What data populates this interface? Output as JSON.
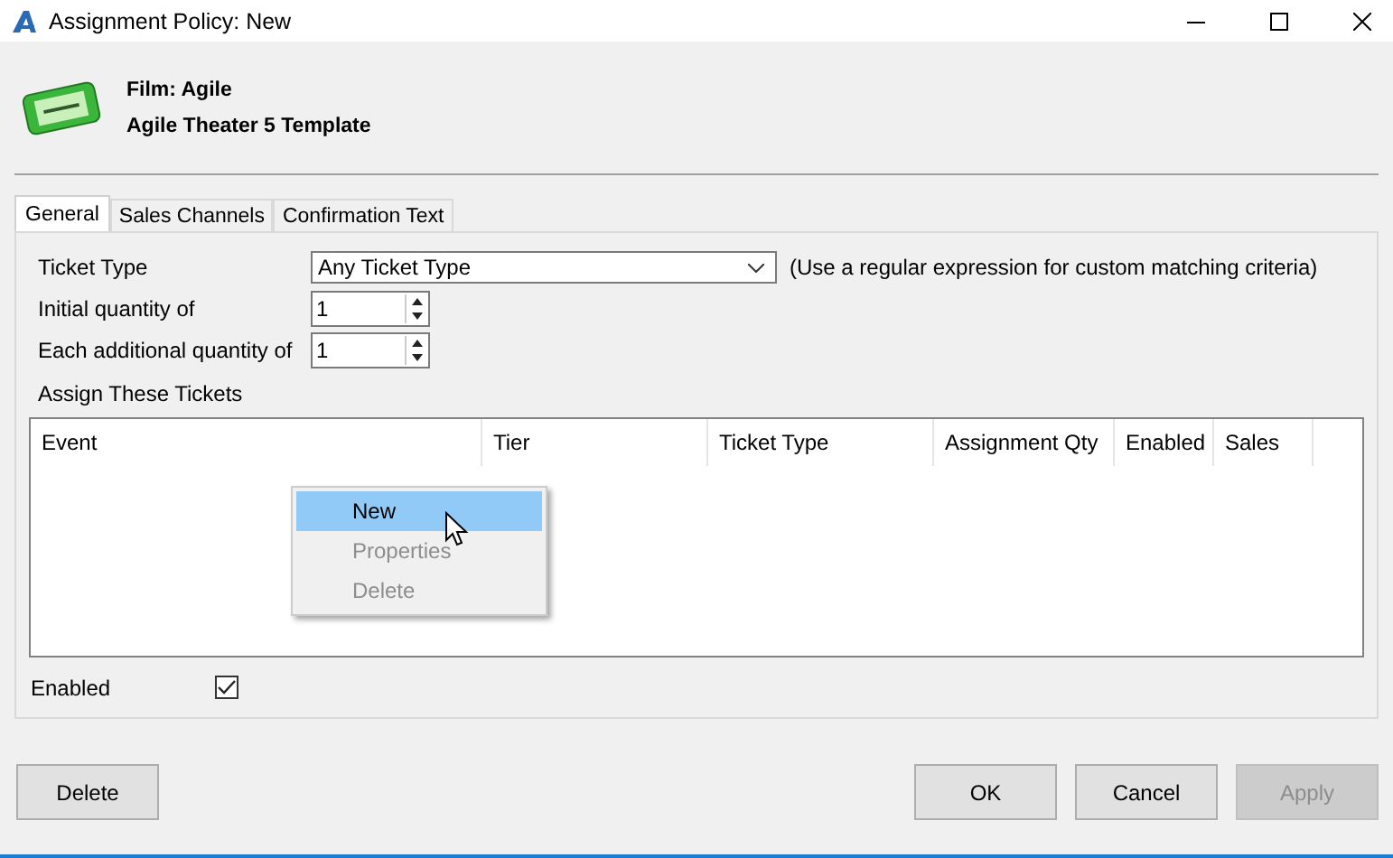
{
  "window": {
    "title": "Assignment Policy: New"
  },
  "header": {
    "film": "Film: Agile",
    "template": "Agile Theater 5 Template"
  },
  "tabs": [
    {
      "label": "General",
      "selected": true
    },
    {
      "label": "Sales Channels",
      "selected": false
    },
    {
      "label": "Confirmation Text",
      "selected": false
    }
  ],
  "form": {
    "ticket_type_label": "Ticket Type",
    "ticket_type_value": "Any Ticket Type",
    "ticket_type_hint": "(Use a regular expression for custom matching criteria)",
    "initial_label": "Initial quantity of",
    "initial_value": "1",
    "additional_label": "Each additional quantity of",
    "additional_value": "1",
    "assign_label": "Assign These Tickets"
  },
  "table": {
    "columns": [
      "Event",
      "Tier",
      "Ticket Type",
      "Assignment Qty",
      "Enabled",
      "Sales"
    ]
  },
  "context_menu": [
    {
      "label": "New",
      "selected": true,
      "disabled": false
    },
    {
      "label": "Properties",
      "selected": false,
      "disabled": true
    },
    {
      "label": "Delete",
      "selected": false,
      "disabled": true
    }
  ],
  "enabled": {
    "label": "Enabled",
    "checked": true
  },
  "buttons": [
    {
      "label": "Delete",
      "disabled": false,
      "kind": "left"
    },
    {
      "label": "OK",
      "disabled": false,
      "kind": "right"
    },
    {
      "label": "Cancel",
      "disabled": false,
      "kind": "right"
    },
    {
      "label": "Apply",
      "disabled": true,
      "kind": "right"
    }
  ]
}
